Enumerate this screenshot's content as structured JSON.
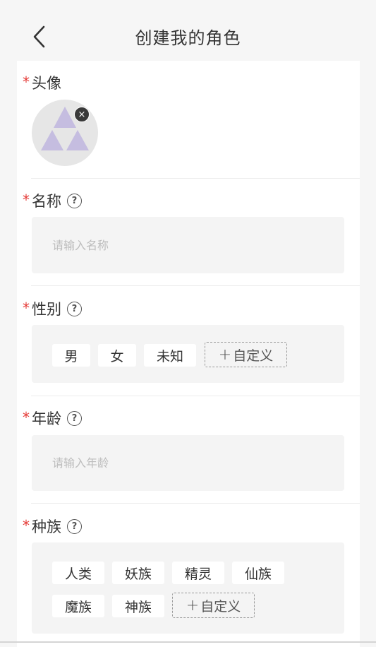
{
  "header": {
    "title": "创建我的角色",
    "back_icon": "chevron-left-icon"
  },
  "avatar_section": {
    "required_mark": "*",
    "label": "头像",
    "remove_icon": "close-icon",
    "remove_symbol": "×"
  },
  "name_section": {
    "required_mark": "*",
    "label": "名称",
    "help_symbol": "?",
    "placeholder": "请输入名称",
    "value": ""
  },
  "gender_section": {
    "required_mark": "*",
    "label": "性别",
    "help_symbol": "?",
    "options": [
      "男",
      "女",
      "未知"
    ],
    "custom_plus": "+",
    "custom_label": "自定义"
  },
  "age_section": {
    "required_mark": "*",
    "label": "年龄",
    "help_symbol": "?",
    "placeholder": "请输入年龄",
    "value": ""
  },
  "race_section": {
    "required_mark": "*",
    "label": "种族",
    "help_symbol": "?",
    "options": [
      "人类",
      "妖族",
      "精灵",
      "仙族",
      "魔族",
      "神族"
    ],
    "custom_plus": "+",
    "custom_label": "自定义"
  },
  "colors": {
    "required": "#e53935",
    "avatar_placeholder": "#c5bde0",
    "field_bg": "#f4f4f4"
  }
}
